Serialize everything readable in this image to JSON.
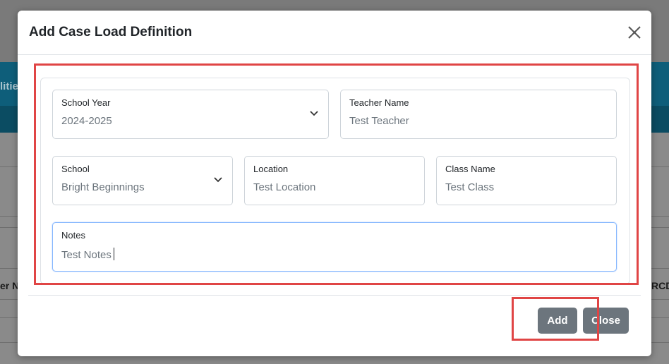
{
  "background": {
    "header_fragment": "litie",
    "left_column_fragment": "er N",
    "right_column_fragment": "RCDT"
  },
  "modal": {
    "title": "Add Case Load Definition",
    "close_icon": "close-icon",
    "fields": {
      "school_year": {
        "label": "School Year",
        "value": "2024-2025"
      },
      "teacher_name": {
        "label": "Teacher Name",
        "value": "Test Teacher"
      },
      "school": {
        "label": "School",
        "value": "Bright Beginnings"
      },
      "location": {
        "label": "Location",
        "value": "Test Location"
      },
      "class_name": {
        "label": "Class Name",
        "value": "Test Class"
      },
      "notes": {
        "label": "Notes",
        "value": "Test Notes"
      }
    },
    "buttons": {
      "add": "Add",
      "close": "Close"
    }
  },
  "colors": {
    "highlight": "#e04545",
    "button": "#6c757d",
    "focus_border": "#86b7fe",
    "backdrop_header": "#0e5e7a"
  }
}
